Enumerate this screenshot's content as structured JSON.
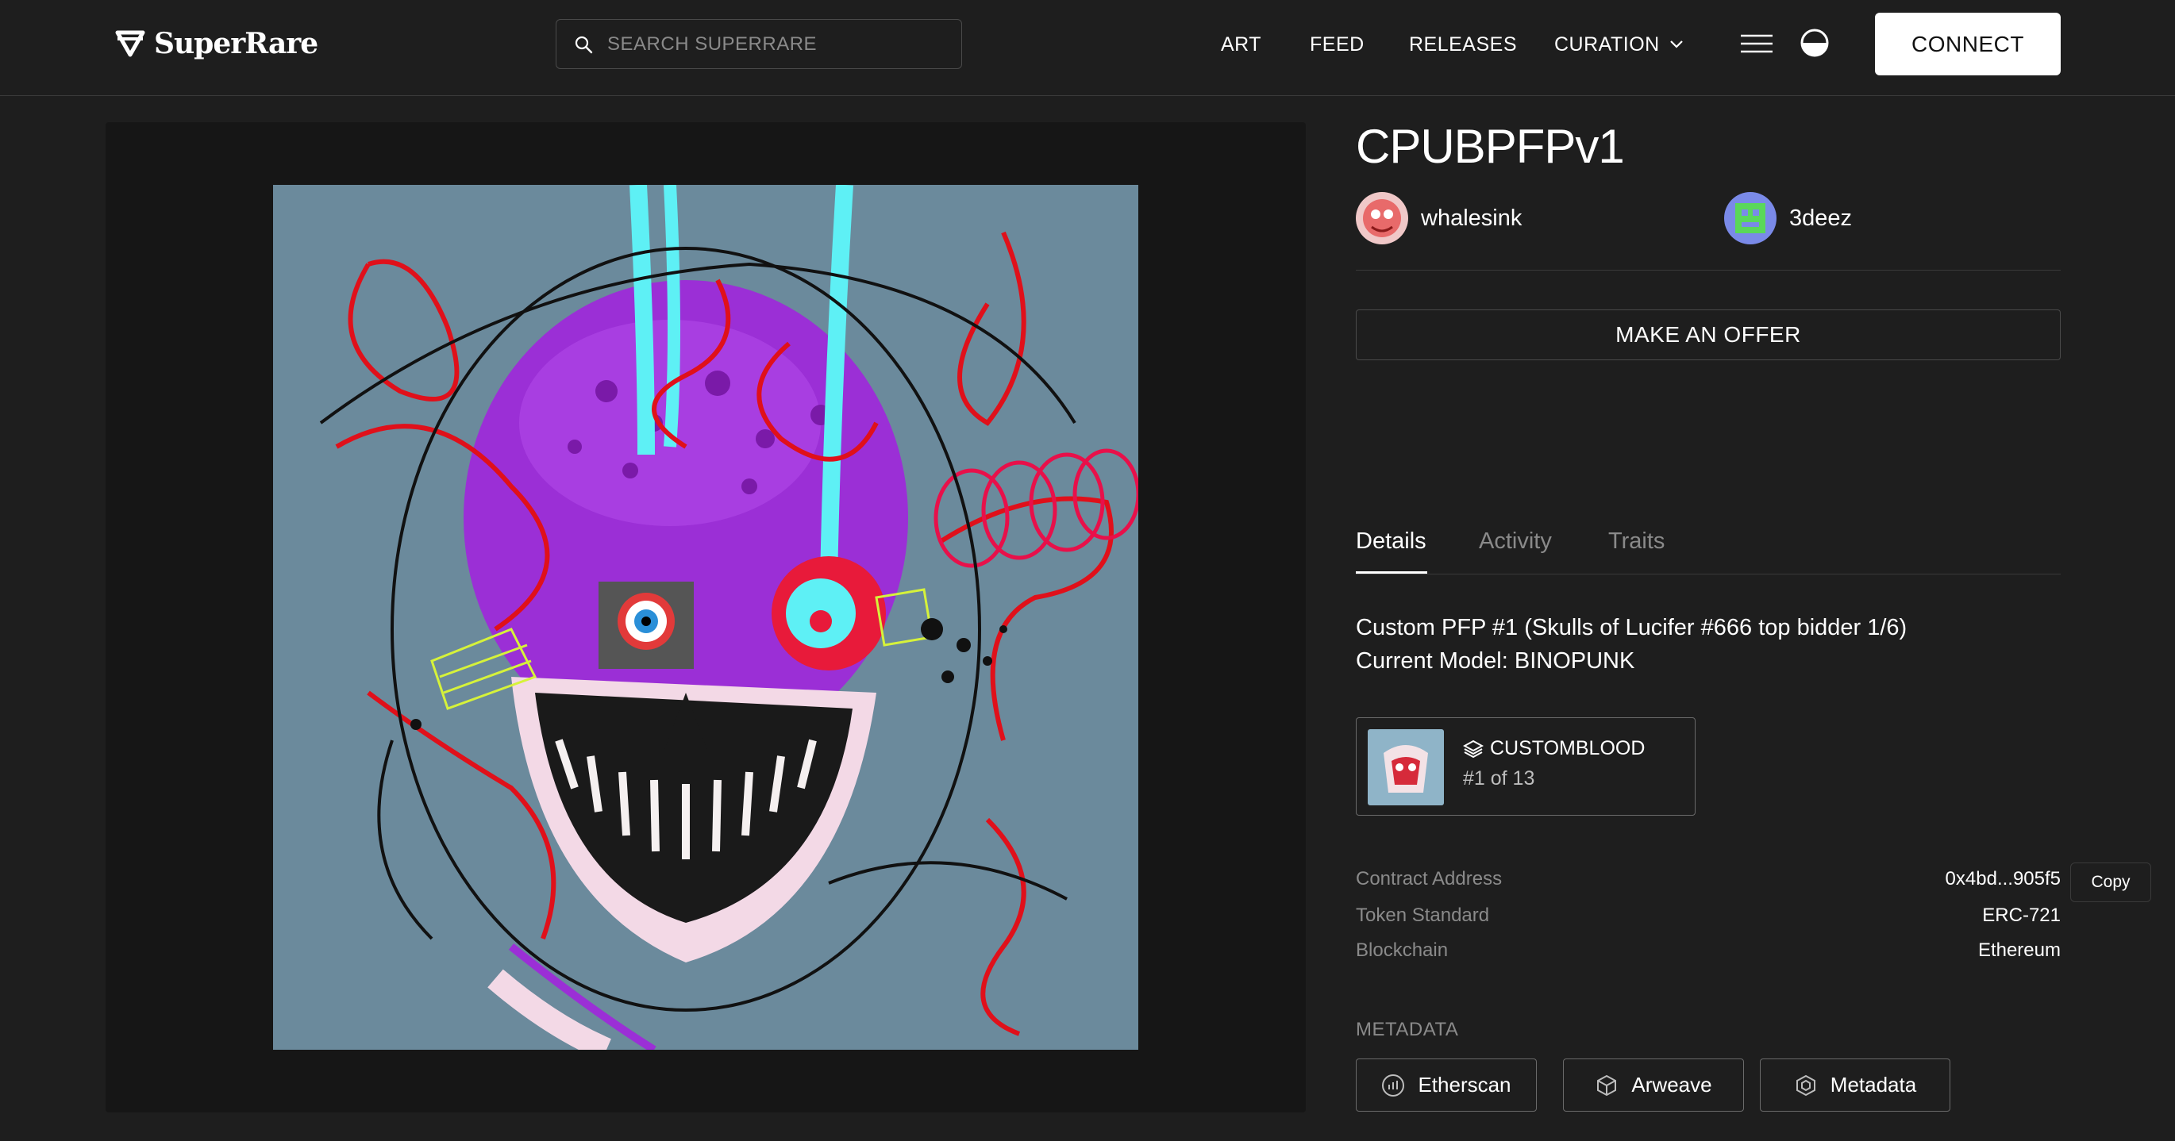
{
  "header": {
    "logo_text": "SuperRare",
    "search_placeholder": "SEARCH SUPERRARE",
    "nav": [
      "ART",
      "FEED",
      "RELEASES",
      "CURATION"
    ],
    "connect_label": "CONNECT"
  },
  "artwork": {
    "title": "CPUBPFPv1",
    "creator": "whalesink",
    "owner": "3deez",
    "offer_label": "MAKE AN OFFER"
  },
  "tabs": [
    "Details",
    "Activity",
    "Traits"
  ],
  "description": {
    "line1": "Custom PFP #1 (Skulls of Lucifer #666 top bidder 1/6)",
    "line2": "Current Model: BINOPUNK"
  },
  "collection": {
    "name": "CUSTOMBLOOD",
    "edition": "#1 of 13"
  },
  "details": {
    "contract_label": "Contract Address",
    "contract_value": "0x4bd...905f5",
    "copy_label": "Copy",
    "standard_label": "Token Standard",
    "standard_value": "ERC-721",
    "chain_label": "Blockchain",
    "chain_value": "Ethereum"
  },
  "metadata": {
    "heading": "METADATA",
    "links": [
      "Etherscan",
      "Arweave",
      "Metadata"
    ]
  },
  "icons": {
    "logo": "diamond-icon",
    "search": "search-icon",
    "curation": "chevron-down-icon",
    "menu": "menu-icon",
    "theme": "theme-toggle-icon",
    "collection": "layers-icon",
    "etherscan": "etherscan-icon",
    "arweave": "cube-icon",
    "metadata": "hexagon-icon"
  },
  "colors": {
    "background": "#1e1e1e",
    "art_panel": "#161616",
    "artwork_bg": "#6b8a9c",
    "accent_connect": "#ffffff"
  }
}
